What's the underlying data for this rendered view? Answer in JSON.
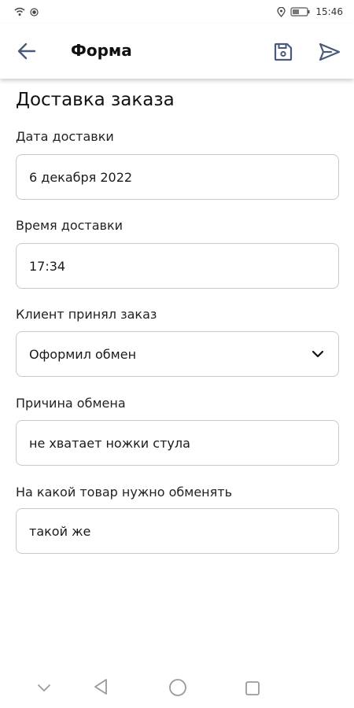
{
  "status_bar": {
    "time": "15:46",
    "icons": [
      "wifi-icon",
      "recording-icon",
      "location-icon",
      "battery-icon"
    ]
  },
  "app_bar": {
    "title": "Форма",
    "icons": [
      "back-arrow-icon",
      "save-icon",
      "send-icon"
    ],
    "accent_color": "#4a5a78"
  },
  "form": {
    "title": "Доставка заказа",
    "fields": [
      {
        "label": "Дата доставки",
        "value": "6 декабря 2022"
      },
      {
        "label": "Время доставки",
        "value": "17:34"
      },
      {
        "label": "Клиент принял заказ",
        "value": "Оформил обмен",
        "type": "select"
      },
      {
        "label": "Причина обмена",
        "value": "не хватает ножки стула"
      },
      {
        "label": "На какой товар нужно обменять",
        "value": "такой же"
      }
    ]
  },
  "nav_bar": {
    "icons": [
      "chevron-down-icon",
      "back-triangle-icon",
      "home-circle-icon",
      "recents-square-icon"
    ]
  }
}
